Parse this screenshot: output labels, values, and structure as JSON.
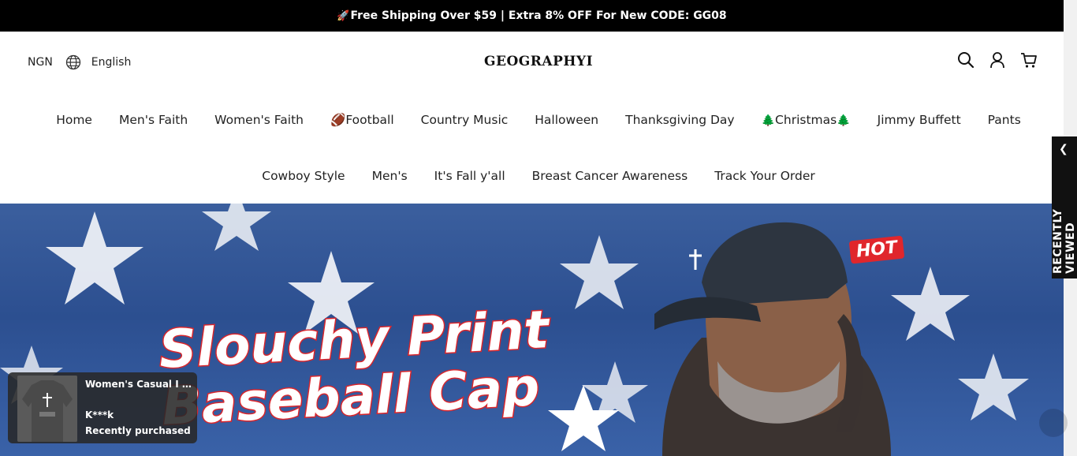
{
  "announcement": {
    "rocket": "🚀",
    "text": "Free Shipping Over $59 | Extra 8% OFF For New CODE: GG08"
  },
  "header": {
    "currency": "NGN",
    "language": "English",
    "logo": "GEOGRAPHYI",
    "icons": [
      "search-icon",
      "account-icon",
      "cart-icon"
    ]
  },
  "nav": {
    "row1": [
      {
        "label": "Home"
      },
      {
        "label": "Men's Faith"
      },
      {
        "label": "Women's Faith"
      },
      {
        "label": "Football",
        "prefix": "🏈"
      },
      {
        "label": "Country Music"
      },
      {
        "label": "Halloween"
      },
      {
        "label": "Thanksgiving Day"
      },
      {
        "label": "Christmas",
        "prefix": "🌲",
        "suffix": "🌲"
      },
      {
        "label": "Jimmy Buffett"
      },
      {
        "label": "Pants"
      }
    ],
    "row2": [
      {
        "label": "Cowboy Style"
      },
      {
        "label": "Men's"
      },
      {
        "label": "It's Fall y'all"
      },
      {
        "label": "Breast Cancer Awareness"
      },
      {
        "label": "Track Your Order"
      }
    ]
  },
  "hero": {
    "line1": "Slouchy Print",
    "line2": "Baseball Cap",
    "badge": "HOT"
  },
  "recently_viewed": {
    "label": "RECENTLY VIEWED",
    "chevron": "❮"
  },
  "purchase_popup": {
    "product": "Women's Casual I C...",
    "buyer": "K***k",
    "status": "Recently purchased"
  },
  "colors": {
    "announcement_bg": "#000000",
    "accent_red": "#d9262c",
    "hero_blue": "#2c4f90"
  }
}
